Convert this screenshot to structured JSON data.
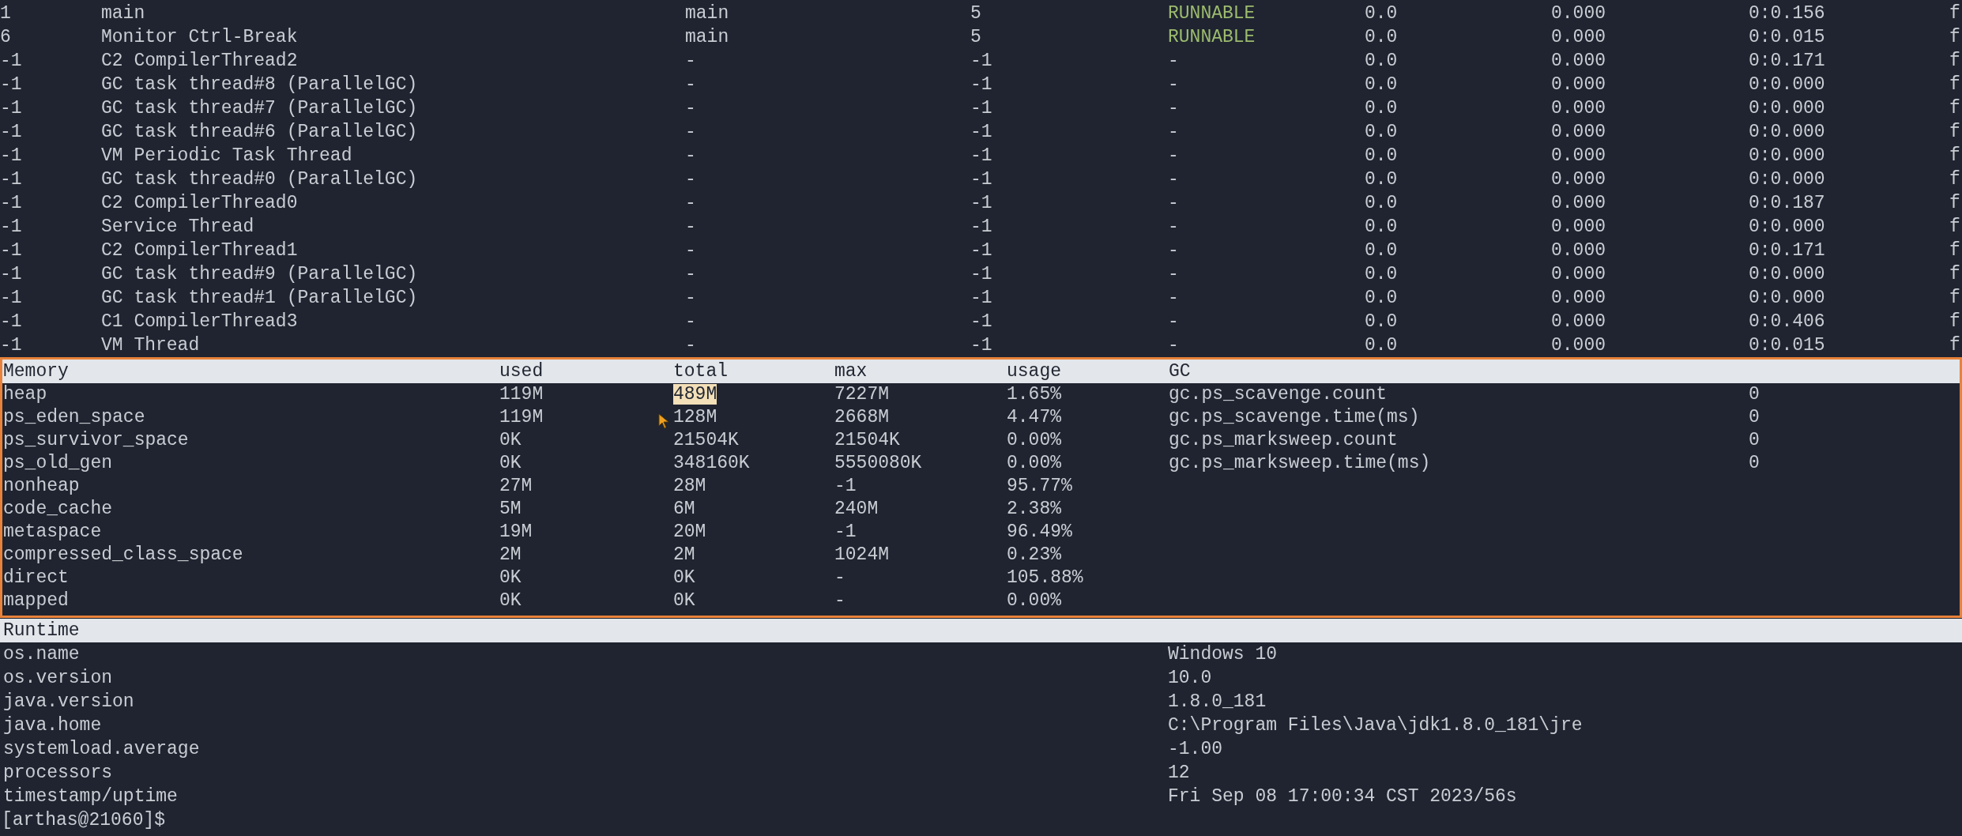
{
  "threads": {
    "rows": [
      {
        "cells": [
          "1",
          "main",
          "main",
          "5",
          "RUNNABLE",
          "0.0",
          "0.000",
          "0:0.156",
          "f"
        ],
        "color": "#9cbb6e"
      },
      {
        "cells": [
          "6",
          "Monitor Ctrl-Break",
          "main",
          "5",
          "RUNNABLE",
          "0.0",
          "0.000",
          "0:0.015",
          "f"
        ],
        "color": "#9cbb6e"
      },
      {
        "cells": [
          "-1",
          "C2 CompilerThread2",
          "-",
          "-1",
          "-",
          "0.0",
          "0.000",
          "0:0.171",
          "f"
        ],
        "color": "#c9cdd3"
      },
      {
        "cells": [
          "-1",
          "GC task thread#8 (ParallelGC)",
          "-",
          "-1",
          "-",
          "0.0",
          "0.000",
          "0:0.000",
          "f"
        ],
        "color": "#c9cdd3"
      },
      {
        "cells": [
          "-1",
          "GC task thread#7 (ParallelGC)",
          "-",
          "-1",
          "-",
          "0.0",
          "0.000",
          "0:0.000",
          "f"
        ],
        "color": "#c9cdd3"
      },
      {
        "cells": [
          "-1",
          "GC task thread#6 (ParallelGC)",
          "-",
          "-1",
          "-",
          "0.0",
          "0.000",
          "0:0.000",
          "f"
        ],
        "color": "#c9cdd3"
      },
      {
        "cells": [
          "-1",
          "VM Periodic Task Thread",
          "-",
          "-1",
          "-",
          "0.0",
          "0.000",
          "0:0.000",
          "f"
        ],
        "color": "#c9cdd3"
      },
      {
        "cells": [
          "-1",
          "GC task thread#0 (ParallelGC)",
          "-",
          "-1",
          "-",
          "0.0",
          "0.000",
          "0:0.000",
          "f"
        ],
        "color": "#c9cdd3"
      },
      {
        "cells": [
          "-1",
          "C2 CompilerThread0",
          "-",
          "-1",
          "-",
          "0.0",
          "0.000",
          "0:0.187",
          "f"
        ],
        "color": "#c9cdd3"
      },
      {
        "cells": [
          "-1",
          "Service Thread",
          "-",
          "-1",
          "-",
          "0.0",
          "0.000",
          "0:0.000",
          "f"
        ],
        "color": "#c9cdd3"
      },
      {
        "cells": [
          "-1",
          "C2 CompilerThread1",
          "-",
          "-1",
          "-",
          "0.0",
          "0.000",
          "0:0.171",
          "f"
        ],
        "color": "#c9cdd3"
      },
      {
        "cells": [
          "-1",
          "GC task thread#9 (ParallelGC)",
          "-",
          "-1",
          "-",
          "0.0",
          "0.000",
          "0:0.000",
          "f"
        ],
        "color": "#c9cdd3"
      },
      {
        "cells": [
          "-1",
          "GC task thread#1 (ParallelGC)",
          "-",
          "-1",
          "-",
          "0.0",
          "0.000",
          "0:0.000",
          "f"
        ],
        "color": "#c9cdd3"
      },
      {
        "cells": [
          "-1",
          "C1 CompilerThread3",
          "-",
          "-1",
          "-",
          "0.0",
          "0.000",
          "0:0.406",
          "f"
        ],
        "color": "#c9cdd3"
      },
      {
        "cells": [
          "-1",
          "VM Thread",
          "-",
          "-1",
          "-",
          "0.0",
          "0.000",
          "0:0.015",
          "f"
        ],
        "color": "#c9cdd3"
      }
    ]
  },
  "memory": {
    "headers": [
      "Memory",
      "used",
      "total",
      "max",
      "usage",
      "GC"
    ],
    "rows": [
      {
        "name": "heap",
        "used": "119M",
        "total": "489M",
        "total_selected": true,
        "max": "7227M",
        "usage": "1.65%"
      },
      {
        "name": "ps_eden_space",
        "used": "119M",
        "total": "128M",
        "total_selected": false,
        "max": "2668M",
        "usage": "4.47%"
      },
      {
        "name": "ps_survivor_space",
        "used": "0K",
        "total": "21504K",
        "total_selected": false,
        "max": "21504K",
        "usage": "0.00%"
      },
      {
        "name": "ps_old_gen",
        "used": "0K",
        "total": "348160K",
        "total_selected": false,
        "max": "5550080K",
        "usage": "0.00%"
      },
      {
        "name": "nonheap",
        "used": "27M",
        "total": "28M",
        "total_selected": false,
        "max": "-1",
        "usage": "95.77%"
      },
      {
        "name": "code_cache",
        "used": "5M",
        "total": "6M",
        "total_selected": false,
        "max": "240M",
        "usage": "2.38%"
      },
      {
        "name": "metaspace",
        "used": "19M",
        "total": "20M",
        "total_selected": false,
        "max": "-1",
        "usage": "96.49%"
      },
      {
        "name": "compressed_class_space",
        "used": "2M",
        "total": "2M",
        "total_selected": false,
        "max": "1024M",
        "usage": "0.23%"
      },
      {
        "name": "direct",
        "used": "0K",
        "total": "0K",
        "total_selected": false,
        "max": "-",
        "usage": "105.88%"
      },
      {
        "name": "mapped",
        "used": "0K",
        "total": "0K",
        "total_selected": false,
        "max": "-",
        "usage": "0.00%"
      }
    ],
    "gc": [
      {
        "name": "gc.ps_scavenge.count",
        "value": "0"
      },
      {
        "name": "gc.ps_scavenge.time(ms)",
        "value": "0"
      },
      {
        "name": "gc.ps_marksweep.count",
        "value": "0"
      },
      {
        "name": "gc.ps_marksweep.time(ms)",
        "value": "0"
      }
    ]
  },
  "runtime": {
    "title": "Runtime",
    "rows": [
      {
        "key": "os.name",
        "value": "Windows 10"
      },
      {
        "key": "os.version",
        "value": "10.0"
      },
      {
        "key": "java.version",
        "value": "1.8.0_181"
      },
      {
        "key": "java.home",
        "value": "C:\\Program Files\\Java\\jdk1.8.0_181\\jre"
      },
      {
        "key": "systemload.average",
        "value": "-1.00"
      },
      {
        "key": "processors",
        "value": "12"
      },
      {
        "key": "timestamp/uptime",
        "value": "Fri Sep 08 17:00:34 CST 2023/56s"
      }
    ]
  },
  "prompt": "[arthas@21060]$"
}
